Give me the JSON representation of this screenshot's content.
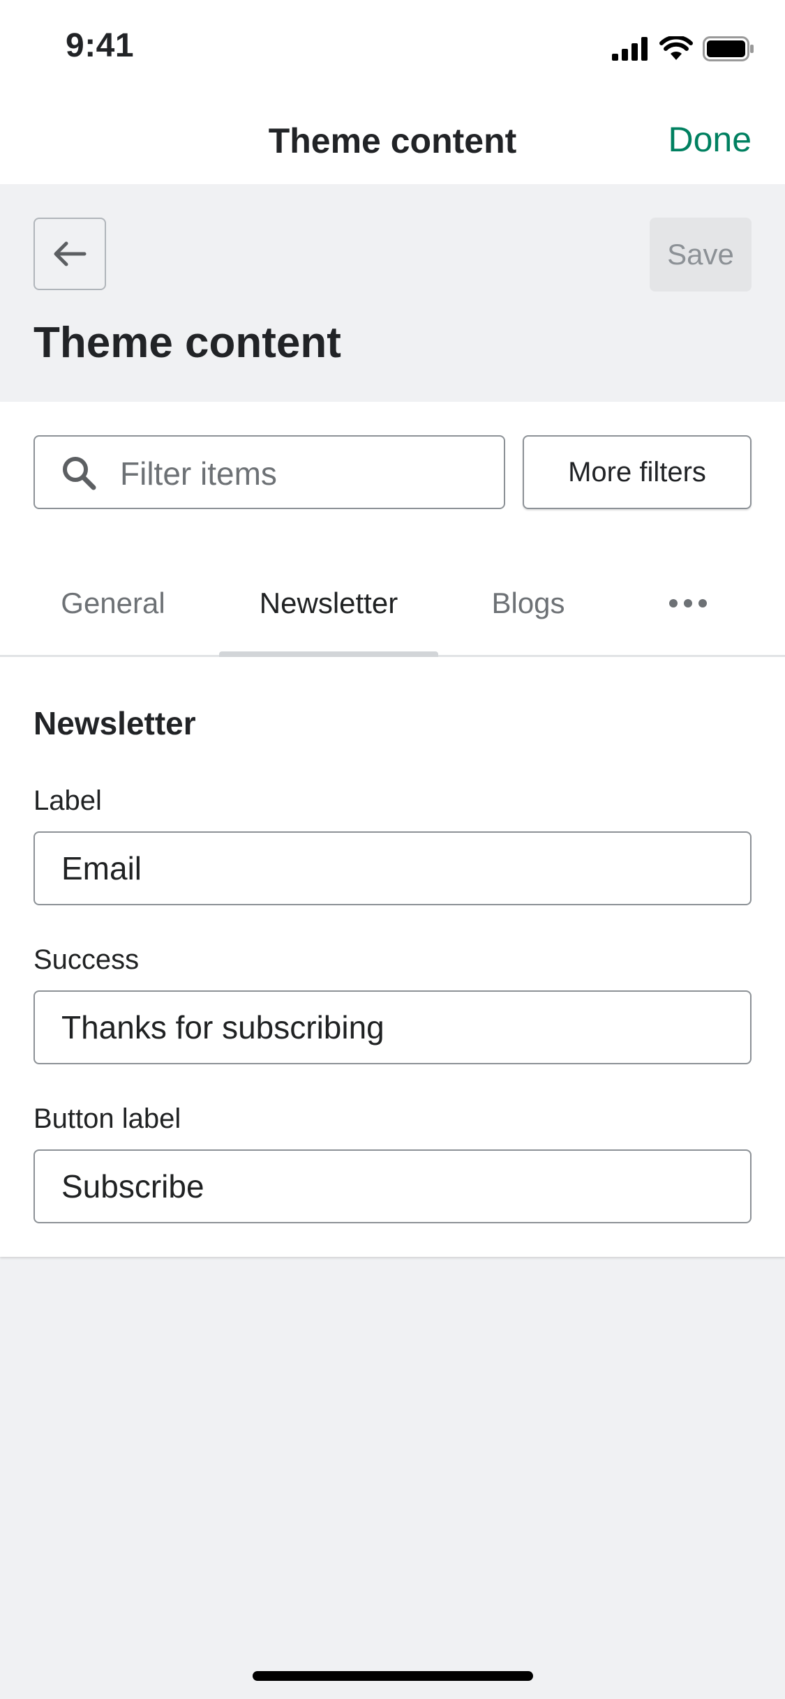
{
  "status_bar": {
    "time": "9:41"
  },
  "nav_bar": {
    "title": "Theme content",
    "done_label": "Done",
    "accent_color": "#008060"
  },
  "header": {
    "back_icon": "arrow-left-icon",
    "save_label": "Save",
    "title": "Theme content"
  },
  "filters": {
    "search_placeholder": "Filter items",
    "more_filters_label": "More filters"
  },
  "tabs": [
    {
      "label": "General",
      "active": false
    },
    {
      "label": "Newsletter",
      "active": true
    },
    {
      "label": "Blogs",
      "active": false
    }
  ],
  "tabs_overflow_icon": "more-horizontal-icon",
  "section": {
    "title": "Newsletter",
    "fields": [
      {
        "label": "Label",
        "value": "Email"
      },
      {
        "label": "Success",
        "value": "Thanks for subscribing"
      },
      {
        "label": "Button label",
        "value": "Subscribe"
      }
    ]
  }
}
